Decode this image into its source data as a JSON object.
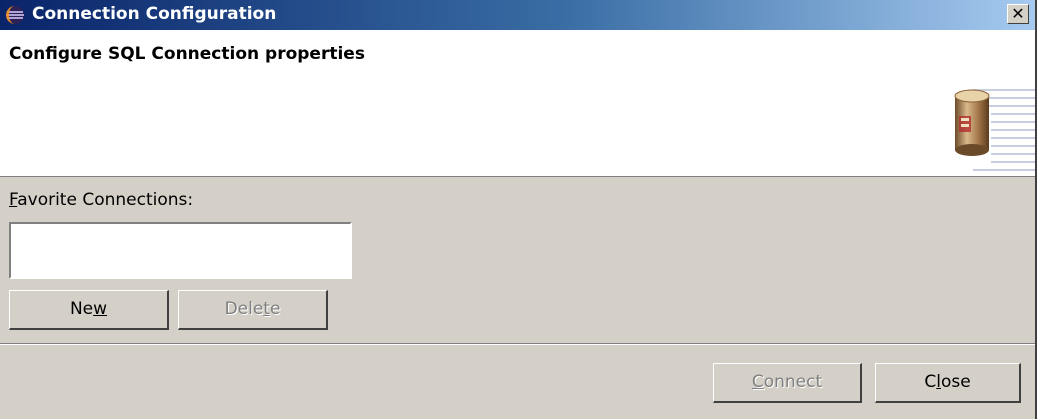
{
  "window": {
    "title": "Connection Configuration",
    "close_symbol": "✕",
    "icon": "eclipse-icon"
  },
  "banner": {
    "title": "Configure SQL Connection properties",
    "image": "database-cylinder-image"
  },
  "favorites": {
    "label": "Favorite Connections:",
    "items": []
  },
  "buttons": {
    "new": "New",
    "delete": "Delete",
    "connect": "Connect",
    "close": "Close"
  }
}
